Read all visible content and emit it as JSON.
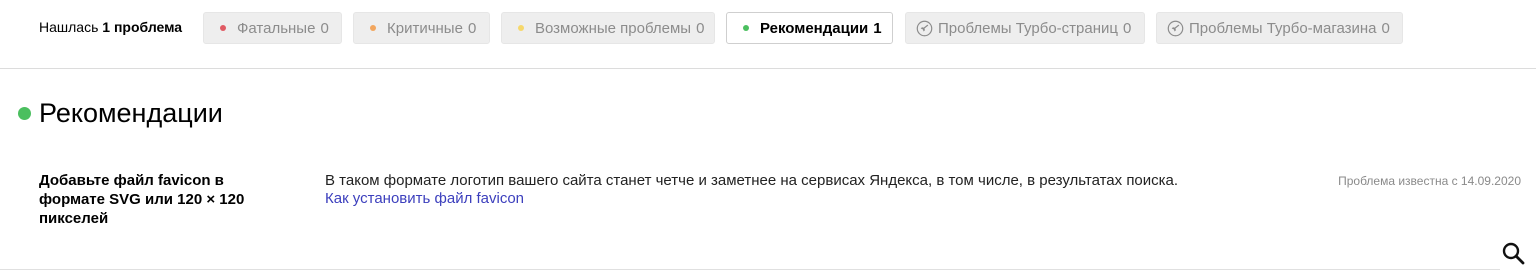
{
  "summary": {
    "prefix": "Нашлась",
    "count_text": "1 проблема"
  },
  "filters": [
    {
      "label": "Фатальные",
      "count": "0",
      "dot_color": "#e05a63",
      "icon": "dot"
    },
    {
      "label": "Критичные",
      "count": "0",
      "dot_color": "#f2a65e",
      "icon": "dot"
    },
    {
      "label": "Возможные проблемы",
      "count": "0",
      "dot_color": "#f6d86b",
      "icon": "dot"
    },
    {
      "label": "Рекомендации",
      "count": "1",
      "dot_color": "#4bbf5f",
      "icon": "dot",
      "active": true
    },
    {
      "label": "Проблемы Турбо-страниц",
      "count": "0",
      "icon": "rocket-icon"
    },
    {
      "label": "Проблемы Турбо-магазина",
      "count": "0",
      "icon": "rocket-icon"
    }
  ],
  "section": {
    "title": "Рекомендации",
    "dot_color": "#4bbf5f"
  },
  "issue": {
    "title": "Добавьте файл favicon в формате SVG или 120 × 120 пикселей",
    "description": "В таком формате логотип вашего сайта станет четче и заметнее на сервисах Яндекса, в том числе, в результатах поиска.",
    "link_text": "Как установить файл favicon",
    "known_since": "Проблема известна с 14.09.2020"
  },
  "colors": {
    "link": "#3c3fbd",
    "chip_background": "#eeeeee"
  }
}
